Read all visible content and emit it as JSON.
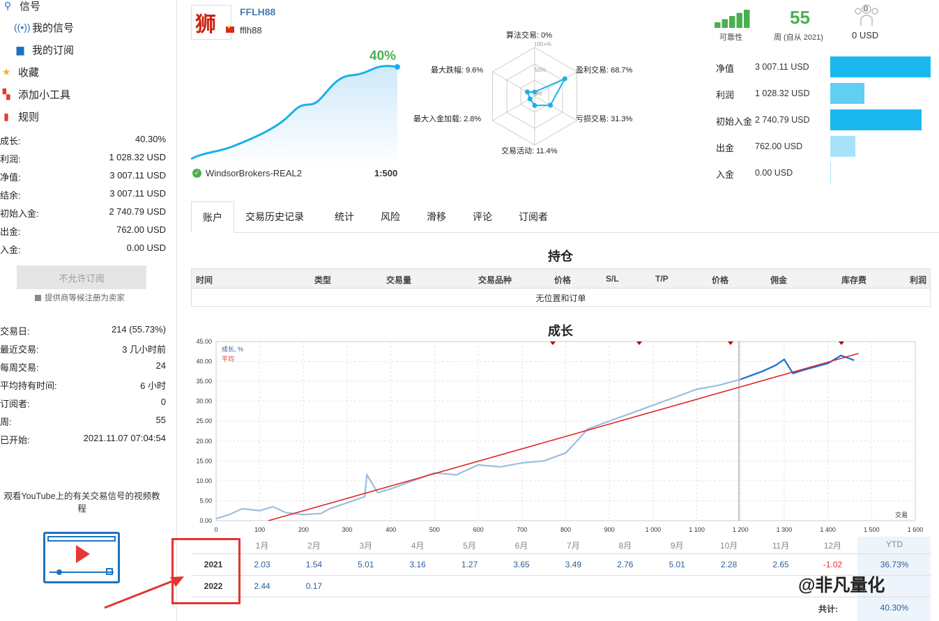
{
  "sidebar": {
    "nav": [
      {
        "label": "信号",
        "icon": "signal-tower-icon"
      },
      {
        "label": "我的信号",
        "icon": "broadcast-icon"
      },
      {
        "label": "我的订阅",
        "icon": "mailbox-icon"
      },
      {
        "label": "收藏",
        "icon": "star-icon"
      },
      {
        "label": "添加小工具",
        "icon": "widgets-icon"
      },
      {
        "label": "规则",
        "icon": "bookmark-icon"
      }
    ],
    "stats": [
      {
        "label": "成长:",
        "value": "40.30%"
      },
      {
        "label": "利润:",
        "value": "1 028.32 USD"
      },
      {
        "label": "净值:",
        "value": "3 007.11 USD"
      },
      {
        "label": "结余:",
        "value": "3 007.11 USD"
      },
      {
        "label": "初始入金:",
        "value": "2 740.79 USD"
      },
      {
        "label": "出金:",
        "value": "762.00 USD"
      },
      {
        "label": "入金:",
        "value": "0.00 USD"
      }
    ],
    "subscribe_button": "不允许订阅",
    "subscribe_note": "提供商等候注册为卖家",
    "stats2": [
      {
        "label": "交易日:",
        "value": "214 (55.73%)"
      },
      {
        "label": "最近交易:",
        "value": "3 几小时前"
      },
      {
        "label": "每周交易:",
        "value": "24"
      },
      {
        "label": "平均持有时间:",
        "value": "6 小时"
      },
      {
        "label": "订阅者:",
        "value": "0"
      },
      {
        "label": "周:",
        "value": "55"
      },
      {
        "label": "已开始:",
        "value": "2021.11.07 07:04:54"
      }
    ],
    "youtube_text": "观看YouTube上的有关交易信号的视频教程"
  },
  "header": {
    "signal_name": "FFLH88",
    "user": "fflh88",
    "growth_pct": "40%",
    "broker": "WindsorBrokers-REAL2",
    "leverage": "1:500",
    "colors": {
      "accent": "#1ab0e8",
      "green": "#4caf50"
    }
  },
  "radar": {
    "labels": {
      "algo": "算法交易: 0%",
      "profit": "盈利交易: 68.7%",
      "loss": "亏损交易: 31.3%",
      "activity": "交易活动: 11.4%",
      "max_load": "最大入金加载: 2.8%",
      "max_dd": "最大跌幅: 9.6%"
    },
    "scale": [
      "100+%",
      "50%",
      "0%"
    ],
    "values": [
      0,
      68.7,
      31.3,
      11.4,
      2.8,
      9.6
    ]
  },
  "topright": {
    "reliability_label": "可靠性",
    "reliability_level": 5,
    "weeks_value": "55",
    "weeks_label": "周 (自从 2021)",
    "subscribers_count": "0",
    "subscribers_value": "0 USD",
    "finance": [
      {
        "label": "净值",
        "value": "3 007.11 USD",
        "amount": 3007.11,
        "color": "#1ab8ef"
      },
      {
        "label": "利润",
        "value": "1 028.32 USD",
        "amount": 1028.32,
        "color": "#5fcff4"
      },
      {
        "label": "初始入金",
        "value": "2 740.79 USD",
        "amount": 2740.79,
        "color": "#1ab8ef"
      },
      {
        "label": "出金",
        "value": "762.00 USD",
        "amount": 762.0,
        "color": "#a8e2f8"
      },
      {
        "label": "入金",
        "value": "0.00 USD",
        "amount": 0.0,
        "color": "#a8e2f8"
      }
    ]
  },
  "tabs": [
    "账户",
    "交易历史记录",
    "统计",
    "风险",
    "滑移",
    "评论",
    "订阅者"
  ],
  "positions": {
    "title": "持仓",
    "columns": [
      "时间",
      "类型",
      "交易量",
      "交易品种",
      "价格",
      "S/L",
      "T/P",
      "价格",
      "佣金",
      "库存费",
      "利润"
    ],
    "empty": "无位置和订单"
  },
  "growth": {
    "title": "成长",
    "legend_growth": "成长, %",
    "legend_avg": "平均",
    "xaxis_label": "交易"
  },
  "chart_data": {
    "type": "line",
    "title": "成长",
    "xlabel": "交易",
    "ylabel": "",
    "xlim": [
      0,
      1600
    ],
    "ylim": [
      0,
      45
    ],
    "xticks": [
      "0",
      "100",
      "200",
      "300",
      "400",
      "500",
      "600",
      "700",
      "800",
      "900",
      "1 000",
      "1 100",
      "1 200",
      "1 300",
      "1 400",
      "1 500",
      "1 600"
    ],
    "yticks": [
      "0.00",
      "5.00",
      "10.00",
      "15.00",
      "20.00",
      "25.00",
      "30.00",
      "35.00",
      "40.00",
      "45.00"
    ],
    "grid": true,
    "legend": "top-left",
    "series": [
      {
        "name": "成长, %",
        "x": [
          0,
          30,
          60,
          100,
          130,
          160,
          200,
          240,
          260,
          300,
          340,
          345,
          370,
          400,
          450,
          500,
          550,
          600,
          650,
          700,
          750,
          800,
          830,
          850,
          900,
          950,
          1000,
          1050,
          1100,
          1150,
          1200,
          1250,
          1280,
          1300,
          1320,
          1350,
          1400,
          1430,
          1460
        ],
        "y": [
          0.5,
          1.5,
          3.0,
          2.5,
          3.5,
          2.0,
          1.5,
          1.8,
          3.0,
          4.5,
          6.0,
          11.5,
          7.0,
          8.0,
          10.0,
          12.0,
          11.5,
          14.0,
          13.5,
          14.5,
          15.0,
          17.0,
          20.5,
          23.0,
          25.0,
          27.0,
          29.0,
          31.0,
          33.0,
          34.0,
          35.5,
          37.5,
          39.0,
          40.5,
          37.0,
          38.0,
          39.5,
          41.5,
          40.3
        ]
      },
      {
        "name": "平均",
        "x": [
          120,
          1470
        ],
        "y": [
          0.0,
          42.0
        ]
      }
    ]
  },
  "monthly": {
    "months": [
      "1月",
      "2月",
      "3月",
      "4月",
      "5月",
      "6月",
      "7月",
      "8月",
      "9月",
      "10月",
      "11月",
      "12月"
    ],
    "ytd_header": "YTD",
    "rows": [
      {
        "year": "2021",
        "values": [
          "2.03",
          "1.54",
          "5.01",
          "3.16",
          "1.27",
          "3.65",
          "3.49",
          "2.76",
          "5.01",
          "2.28",
          "2.65",
          "-1.02"
        ],
        "ytd": "36.73%"
      },
      {
        "year": "2022",
        "values": [
          "2.44",
          "0.17",
          "",
          "",
          "",
          "",
          "",
          "",
          "",
          "",
          "",
          ""
        ],
        "ytd": ""
      }
    ],
    "total_label": "共计:",
    "total_value": "40.30%"
  },
  "watermark": "@非凡量化"
}
